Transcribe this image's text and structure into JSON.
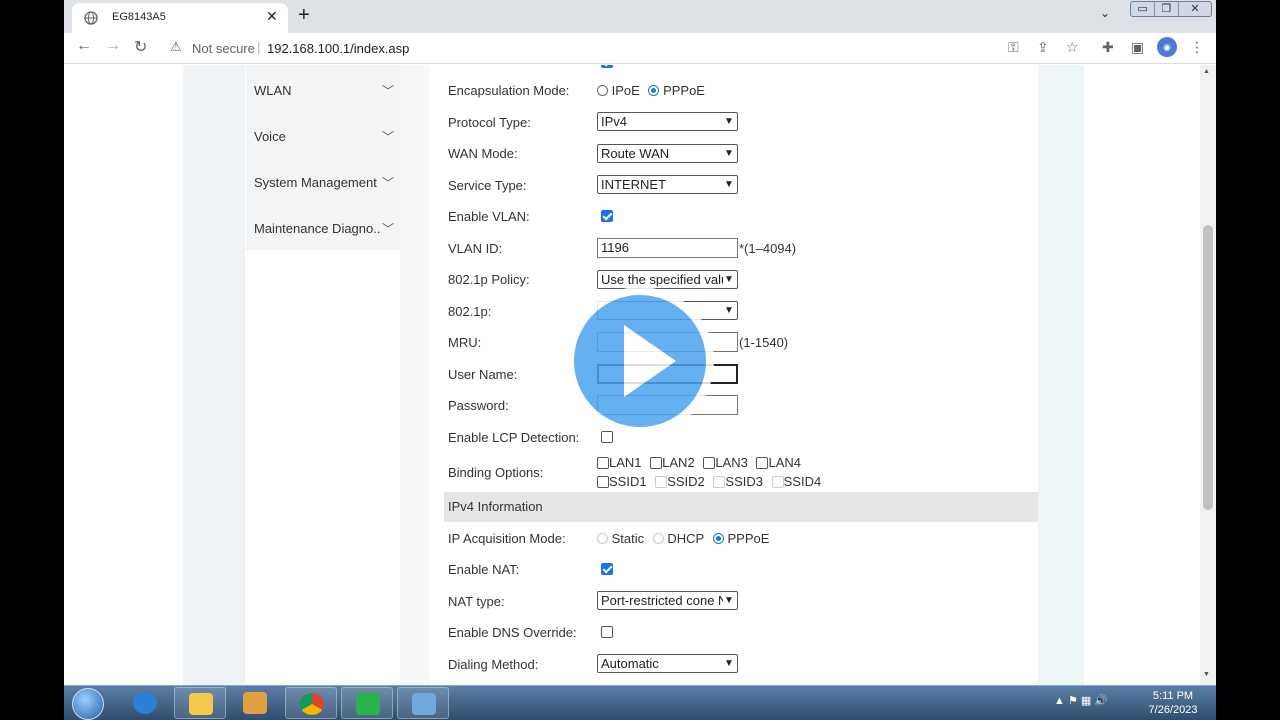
{
  "browser": {
    "tab_title": "EG8143A5",
    "tab_close": "✕",
    "new_tab": "+",
    "not_secure": "Not secure",
    "url": "192.168.100.1/index.asp",
    "profile": "",
    "window_buttons": [
      "▭",
      "❐",
      "✕"
    ]
  },
  "sidebar": {
    "items": [
      {
        "label": "WLAN"
      },
      {
        "label": "Voice"
      },
      {
        "label": "System Management"
      },
      {
        "label": "Maintenance Diagno.."
      }
    ]
  },
  "form": {
    "encapsulation": {
      "label": "Encapsulation Mode:",
      "options": [
        "IPoE",
        "PPPoE"
      ],
      "selected": "PPPoE"
    },
    "protocol_type": {
      "label": "Protocol Type:",
      "value": "IPv4"
    },
    "wan_mode": {
      "label": "WAN Mode:",
      "value": "Route WAN"
    },
    "service_type": {
      "label": "Service Type:",
      "value": "INTERNET"
    },
    "enable_vlan": {
      "label": "Enable VLAN:",
      "checked": true
    },
    "vlan_id": {
      "label": "VLAN ID:",
      "value": "1196",
      "hint": "*(1–4094)"
    },
    "policy_8021p": {
      "label": "802.1p Policy:",
      "value": "Use the specified valu"
    },
    "p8021": {
      "label": "802.1p:",
      "value": ""
    },
    "mru": {
      "label": "MRU:",
      "value": "",
      "hint": "(1-1540)"
    },
    "user_name": {
      "label": "User Name:",
      "value": ""
    },
    "password": {
      "label": "Password:",
      "value": ""
    },
    "lcp": {
      "label": "Enable LCP Detection:",
      "checked": false
    },
    "binding": {
      "label": "Binding Options:",
      "lan": [
        "LAN1",
        "LAN2",
        "LAN3",
        "LAN4"
      ],
      "ssid": [
        "SSID1",
        "SSID2",
        "SSID3",
        "SSID4"
      ]
    },
    "ipv4_section": "IPv4 Information",
    "ip_acq": {
      "label": "IP Acquisition Mode:",
      "options": [
        "Static",
        "DHCP",
        "PPPoE"
      ],
      "selected": "PPPoE"
    },
    "enable_nat": {
      "label": "Enable NAT:",
      "checked": true
    },
    "nat_type": {
      "label": "NAT type:",
      "value": "Port-restricted cone N"
    },
    "dns_override": {
      "label": "Enable DNS Override:",
      "checked": false
    },
    "dialing": {
      "label": "Dialing Method:",
      "value": "Automatic"
    }
  },
  "taskbar": {
    "time": "5:11 PM",
    "date": "7/26/2023"
  }
}
